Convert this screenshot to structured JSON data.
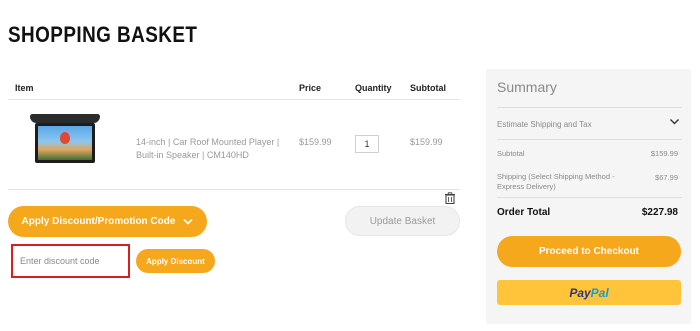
{
  "page": {
    "title": "SHOPPING BASKET"
  },
  "cart": {
    "columns": {
      "item": "Item",
      "price": "Price",
      "quantity": "Quantity",
      "subtotal": "Subtotal"
    },
    "items": [
      {
        "name": "14-inch | Car Roof Mounted Player | Built-in Speaker | CM140HD",
        "price": "$159.99",
        "quantity": "1",
        "subtotal": "$159.99",
        "image_icon": "car-roof-player-image"
      }
    ],
    "remove_icon": "trash-icon"
  },
  "actions": {
    "discount_toggle_label": "Apply Discount/Promotion Code",
    "update_label": "Update Basket",
    "discount_placeholder": "Enter discount code",
    "discount_value": "",
    "apply_label": "Apply Discount"
  },
  "summary": {
    "title": "Summary",
    "estimate_label": "Estimate Shipping and Tax",
    "subtotal_label": "Subtotal",
    "subtotal_value": "$159.99",
    "shipping_label": "Shipping (Select Shipping Method - Express Delivery)",
    "shipping_value": "$67.99",
    "total_label": "Order Total",
    "total_value": "$227.98",
    "checkout_label": "Proceed to Checkout",
    "paypal_part1": "Pay",
    "paypal_part2": "Pal"
  },
  "colors": {
    "accent": "#f6a81d",
    "paypal_bg": "#ffc439",
    "highlight_border": "#d62020"
  }
}
